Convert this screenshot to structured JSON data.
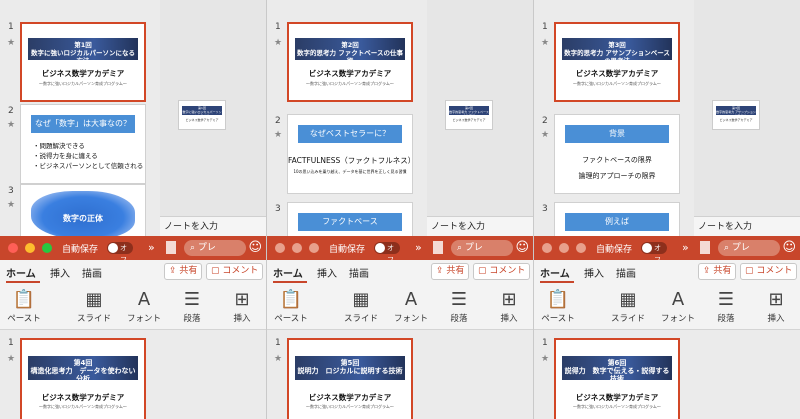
{
  "top_panes": [
    {
      "slides": [
        {
          "num": "1",
          "banner_l1": "第1回",
          "banner_l2": "数字に強いロジカルパーソンになる方法",
          "academy": "ビジネス数学アカデミア",
          "academy_sub": "〜数字に強いロジカルパーソン育成プログラム〜"
        },
        {
          "num": "2",
          "bar": "なぜ「数字」は大事なの？",
          "bullets": [
            "・問題解決できる",
            "・説得力を身に纏える",
            "・ビジネスパーソンとして信頼される"
          ]
        },
        {
          "num": "3",
          "blob": "数字の正体"
        }
      ],
      "mini": {
        "l1": "第1回",
        "l2": "数字に強いロジカルパーソンになる方法",
        "sub": "ビジネス数学アカデミア"
      },
      "notes": "ノートを入力"
    },
    {
      "slides": [
        {
          "num": "1",
          "banner_l1": "第2回",
          "banner_l2": "数字的思考力 ファクトベースの仕事術",
          "academy": "ビジネス数学アカデミア",
          "academy_sub": "〜数字に強いロジカルパーソン育成プログラム〜"
        },
        {
          "num": "2",
          "bar": "なぜベストセラーに？",
          "line1": "FACTFULNESS（ファクトフルネス）",
          "line2": "10の思い込みを乗り越え、データを基に世界を正しく見る習慣"
        },
        {
          "num": "3",
          "bar": "ファクトベース"
        }
      ],
      "mini": {
        "l1": "第2回",
        "l2": "数字的思考力 ファクトベースの仕事術",
        "sub": "ビジネス数学アカデミア"
      },
      "notes": "ノートを入力"
    },
    {
      "slides": [
        {
          "num": "1",
          "banner_l1": "第3回",
          "banner_l2": "数字的思考力 アサンプションベースの思考法",
          "academy": "ビジネス数学アカデミア",
          "academy_sub": "〜数字に強いロジカルパーソン育成プログラム〜"
        },
        {
          "num": "2",
          "bar": "背景",
          "line1": "ファクトベースの限界",
          "line2": "論理的アプローチの限界"
        },
        {
          "num": "3",
          "bar": "例えば"
        }
      ],
      "mini": {
        "l1": "第3回",
        "l2": "数字的思考力 アサンプションベースの思考法",
        "sub": "ビジネス数学アカデミア"
      },
      "notes": "ノートを入力"
    }
  ],
  "window": {
    "autosave": "自動保存",
    "toggle": "オフ",
    "search": "プレ",
    "tabs": [
      "ホーム",
      "挿入",
      "描画"
    ],
    "share": "共有",
    "comment": "コメント",
    "ribbon": [
      {
        "icon": "clipboard-icon",
        "label": "ペースト"
      },
      {
        "icon": "slide-layout-icon",
        "label": "スライド"
      },
      {
        "icon": "font-icon",
        "label": "フォント"
      },
      {
        "icon": "paragraph-icon",
        "label": "段落"
      },
      {
        "icon": "insert-icon",
        "label": "挿入"
      }
    ],
    "colors": {
      "titlebar": "#c8462b",
      "accent": "#d24726",
      "blue": "#4a8fd6"
    }
  },
  "bottom_panes": [
    {
      "num": "1",
      "banner_l1": "第4回",
      "banner_l2": "構造化思考力　データを使わない分析",
      "academy": "ビジネス数学アカデミア",
      "academy_sub": "〜数字に強いロジカルパーソン育成プログラム〜"
    },
    {
      "num": "1",
      "banner_l1": "第5回",
      "banner_l2": "説明力　ロジカルに説明する技術",
      "academy": "ビジネス数学アカデミア",
      "academy_sub": "〜数字に強いロジカルパーソン育成プログラム〜"
    },
    {
      "num": "1",
      "banner_l1": "第6回",
      "banner_l2": "説得力　数字で伝える・説得する技術",
      "academy": "ビジネス数学アカデミア",
      "academy_sub": "〜数字に強いロジカルパーソン育成プログラム〜"
    }
  ]
}
